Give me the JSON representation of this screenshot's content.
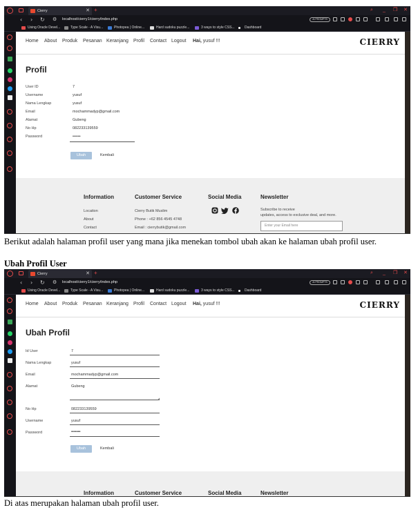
{
  "browser": {
    "tab_title": "Cierry",
    "url": "localhost/cierry1/cierry/index.php",
    "ai_prompts_label": "AI PROMPTS",
    "bookmarks": [
      "Using Oracle Devel...",
      "Type Scale - A Visu...",
      "Photopea | Online...",
      "Hard sudoku puzzle...",
      "3 ways to style CSS...",
      "Dashboard"
    ]
  },
  "site": {
    "nav": [
      "Home",
      "About",
      "Produk",
      "Pesanan",
      "Keranjang",
      "Profil",
      "Contact",
      "Logout"
    ],
    "greeting_prefix": "Hai,",
    "greeting_user_1": "yusuf !!!",
    "greeting_user_2": "yusuf !!!",
    "brand": "CIERRY"
  },
  "profil_page": {
    "title": "Profil",
    "fields": [
      {
        "label": "User ID",
        "value": "7"
      },
      {
        "label": "Username",
        "value": "yusuf"
      },
      {
        "label": "Nama Lengkap",
        "value": "yusuf"
      },
      {
        "label": "Email",
        "value": "mochammadyp@gmail.com"
      },
      {
        "label": "Alamat",
        "value": "Gubeng"
      },
      {
        "label": "No Hp",
        "value": "082233139559"
      },
      {
        "label": "Password",
        "value": "••••••"
      }
    ],
    "button_ubah": "Ubah",
    "button_kembali": "Kembali"
  },
  "ubah_page": {
    "title": "Ubah Profil",
    "fields": [
      {
        "label": "Id User",
        "value": "7"
      },
      {
        "label": "Nama Lengkap",
        "value": "yusuf"
      },
      {
        "label": "Email",
        "value": "mochammadyp@gmail.com"
      },
      {
        "label": "Alamat",
        "value": "Gubeng"
      },
      {
        "label": "No Hp",
        "value": "082233139559"
      },
      {
        "label": "Username",
        "value": "yusuf"
      },
      {
        "label": "Password",
        "value": "•••••••"
      }
    ],
    "button_ubah": "Ubah",
    "button_kembali": "Kembali"
  },
  "footer": {
    "information_title": "Information",
    "information_links": [
      "Location",
      "About",
      "Contact"
    ],
    "customer_service_title": "Customer Service",
    "customer_service_lines": [
      "Cierry Butik Muslim",
      "Phone : +62 856 4545 4748",
      "Email : cierrybutik@gmail.com"
    ],
    "social_title": "Social Media",
    "social_icons": [
      "instagram-icon",
      "twitter-icon",
      "facebook-icon"
    ],
    "newsletter_title": "Newsletter",
    "newsletter_text_1": "Subscribe to receive",
    "newsletter_text_2": "updates, access to exclusive deal, and more.",
    "email_placeholder": "Enter your Email here"
  },
  "document": {
    "caption_1": "Berikut adalah halaman profil user yang mana jika menekan tombol ubah akan ke halaman ubah profil user.",
    "heading": "Ubah Profil User",
    "caption_2": "Di atas merupakan halaman ubah profil user."
  }
}
